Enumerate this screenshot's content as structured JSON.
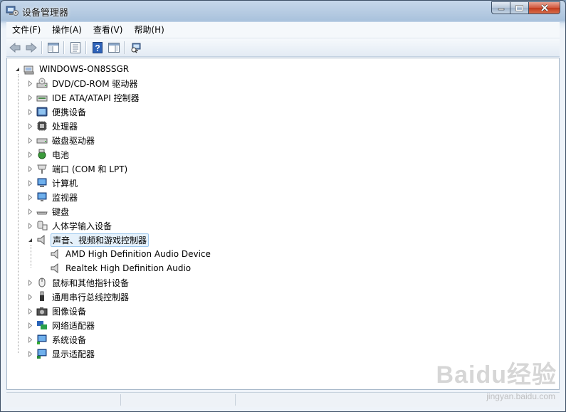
{
  "window": {
    "title": "设备管理器",
    "controls": {
      "minimize": "minimize",
      "maximize": "maximize",
      "close": "close"
    }
  },
  "menu": [
    "文件(F)",
    "操作(A)",
    "查看(V)",
    "帮助(H)"
  ],
  "toolbar": [
    "back-arrow-icon",
    "forward-arrow-icon",
    "show-hide-tree-icon",
    "properties-icon",
    "help-icon",
    "action-view-icon",
    "scan-hardware-icon"
  ],
  "tree": {
    "root": "WINDOWS-ON8SSGR",
    "categories": [
      {
        "label": "DVD/CD-ROM 驱动器",
        "icon": "dvd-drive-icon",
        "expanded": false
      },
      {
        "label": "IDE ATA/ATAPI 控制器",
        "icon": "ide-controller-icon",
        "expanded": false
      },
      {
        "label": "便携设备",
        "icon": "portable-device-icon",
        "expanded": false
      },
      {
        "label": "处理器",
        "icon": "processor-icon",
        "expanded": false
      },
      {
        "label": "磁盘驱动器",
        "icon": "disk-drive-icon",
        "expanded": false
      },
      {
        "label": "电池",
        "icon": "battery-icon",
        "expanded": false
      },
      {
        "label": "端口 (COM 和 LPT)",
        "icon": "port-icon",
        "expanded": false
      },
      {
        "label": "计算机",
        "icon": "computer-icon",
        "expanded": false
      },
      {
        "label": "监视器",
        "icon": "monitor-icon",
        "expanded": false
      },
      {
        "label": "键盘",
        "icon": "keyboard-icon",
        "expanded": false
      },
      {
        "label": "人体学输入设备",
        "icon": "hid-icon",
        "expanded": false
      },
      {
        "label": "声音、视频和游戏控制器",
        "icon": "speaker-icon",
        "expanded": true,
        "selected": true,
        "children": [
          "AMD High Definition Audio Device",
          "Realtek High Definition Audio"
        ]
      },
      {
        "label": "鼠标和其他指针设备",
        "icon": "mouse-icon",
        "expanded": false
      },
      {
        "label": "通用串行总线控制器",
        "icon": "usb-icon",
        "expanded": false
      },
      {
        "label": "图像设备",
        "icon": "camera-icon",
        "expanded": false
      },
      {
        "label": "网络适配器",
        "icon": "network-adapter-icon",
        "expanded": false
      },
      {
        "label": "系统设备",
        "icon": "system-device-icon",
        "expanded": false
      },
      {
        "label": "显示适配器",
        "icon": "display-adapter-icon",
        "expanded": false
      }
    ]
  },
  "watermark": {
    "logo": "Baidu经验",
    "url": "jingyan.baidu.com"
  }
}
